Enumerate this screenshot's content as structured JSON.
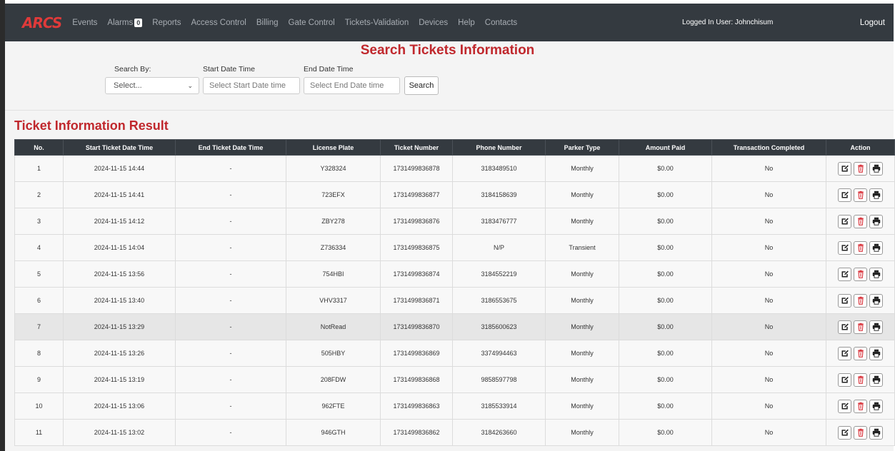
{
  "nav": {
    "logo": "ARCS",
    "items": [
      "Events",
      "Alarms",
      "Reports",
      "Access Control",
      "Billing",
      "Gate Control",
      "Tickets-Validation",
      "Devices",
      "Help",
      "Contacts"
    ],
    "alarm_count": "0",
    "user_label": "Logged In User: Johnchisum",
    "logout": "Logout"
  },
  "search": {
    "title": "Search Tickets Information",
    "search_by_label": "Search By:",
    "search_by_value": "Select...",
    "start_label": "Start Date Time",
    "start_placeholder": "Select Start Date time",
    "end_label": "End Date Time",
    "end_placeholder": "Select End Date time",
    "button": "Search"
  },
  "results": {
    "title": "Ticket Information Result",
    "columns": [
      "No.",
      "Start Ticket Date Time",
      "End Ticket Date Time",
      "License Plate",
      "Ticket Number",
      "Phone Number",
      "Parker Type",
      "Amount Paid",
      "Transaction Completed",
      "Action"
    ],
    "rows": [
      [
        "1",
        "2024-11-15 14:44",
        "-",
        "Y328324",
        "1731499836878",
        "3183489510",
        "Monthly",
        "$0.00",
        "No"
      ],
      [
        "2",
        "2024-11-15 14:41",
        "-",
        "723EFX",
        "1731499836877",
        "3184158639",
        "Monthly",
        "$0.00",
        "No"
      ],
      [
        "3",
        "2024-11-15 14:12",
        "-",
        "ZBY278",
        "1731499836876",
        "3183476777",
        "Monthly",
        "$0.00",
        "No"
      ],
      [
        "4",
        "2024-11-15 14:04",
        "-",
        "Z736334",
        "1731499836875",
        "N/P",
        "Transient",
        "$0.00",
        "No"
      ],
      [
        "5",
        "2024-11-15 13:56",
        "-",
        "754HBI",
        "1731499836874",
        "3184552219",
        "Monthly",
        "$0.00",
        "No"
      ],
      [
        "6",
        "2024-11-15 13:40",
        "-",
        "VHV3317",
        "1731499836871",
        "3186553675",
        "Monthly",
        "$0.00",
        "No"
      ],
      [
        "7",
        "2024-11-15 13:29",
        "-",
        "NotRead",
        "1731499836870",
        "3185600623",
        "Monthly",
        "$0.00",
        "No"
      ],
      [
        "8",
        "2024-11-15 13:26",
        "-",
        "505HBY",
        "1731499836869",
        "3374994463",
        "Monthly",
        "$0.00",
        "No"
      ],
      [
        "9",
        "2024-11-15 13:19",
        "-",
        "208FDW",
        "1731499836868",
        "9858597798",
        "Monthly",
        "$0.00",
        "No"
      ],
      [
        "10",
        "2024-11-15 13:06",
        "-",
        "962FTE",
        "1731499836863",
        "3185533914",
        "Monthly",
        "$0.00",
        "No"
      ],
      [
        "11",
        "2024-11-15 13:02",
        "-",
        "946GTH",
        "1731499836862",
        "3184263660",
        "Monthly",
        "$0.00",
        "No"
      ]
    ],
    "highlighted_row": 7,
    "action_icons": [
      "edit-icon",
      "delete-icon",
      "print-icon"
    ]
  },
  "colors": {
    "navbar": "#343a40",
    "accent_red": "#c0282d",
    "delete_red": "#d9363e"
  }
}
